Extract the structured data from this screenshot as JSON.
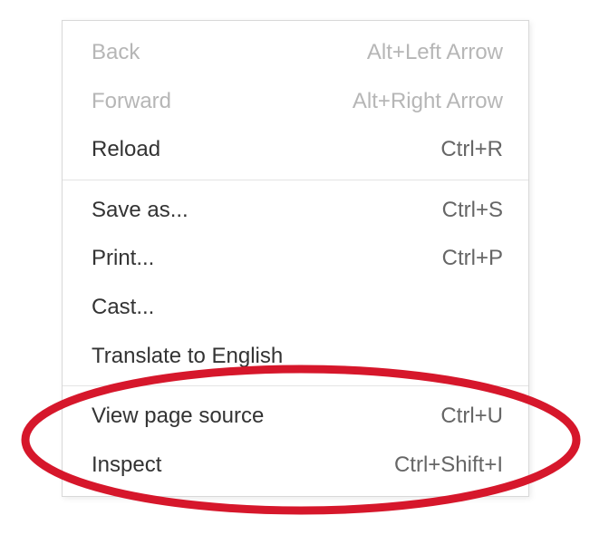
{
  "menu": {
    "groups": [
      [
        {
          "id": "back",
          "label": "Back",
          "shortcut": "Alt+Left Arrow",
          "disabled": true
        },
        {
          "id": "forward",
          "label": "Forward",
          "shortcut": "Alt+Right Arrow",
          "disabled": true
        },
        {
          "id": "reload",
          "label": "Reload",
          "shortcut": "Ctrl+R",
          "disabled": false
        }
      ],
      [
        {
          "id": "save-as",
          "label": "Save as...",
          "shortcut": "Ctrl+S",
          "disabled": false
        },
        {
          "id": "print",
          "label": "Print...",
          "shortcut": "Ctrl+P",
          "disabled": false
        },
        {
          "id": "cast",
          "label": "Cast...",
          "shortcut": "",
          "disabled": false
        },
        {
          "id": "translate",
          "label": "Translate to English",
          "shortcut": "",
          "disabled": false
        }
      ],
      [
        {
          "id": "view-source",
          "label": "View page source",
          "shortcut": "Ctrl+U",
          "disabled": false
        },
        {
          "id": "inspect",
          "label": "Inspect",
          "shortcut": "Ctrl+Shift+I",
          "disabled": false
        }
      ]
    ]
  },
  "annotation": {
    "shape": "ellipse",
    "color": "#d6172b",
    "highlights": [
      "view-source",
      "inspect"
    ]
  }
}
